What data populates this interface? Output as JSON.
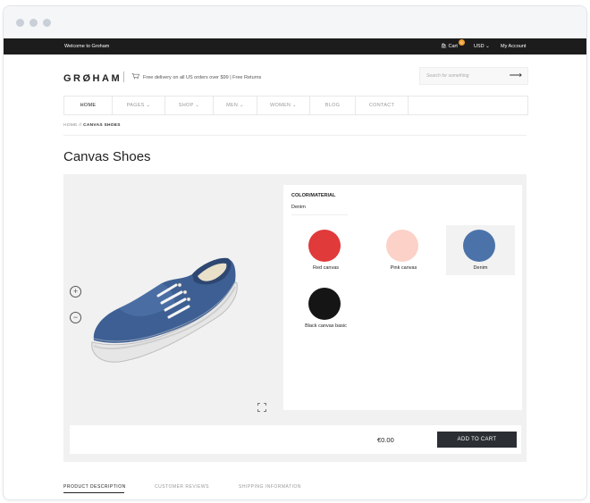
{
  "topbar": {
    "welcome": "Welcome to Groham",
    "cart_label": "Cart",
    "cart_count": "0",
    "currency": "USD",
    "account": "My Account"
  },
  "header": {
    "logo": "GRØHAM",
    "free_delivery": "Free delivery on all US orders over $99 | Free Returns",
    "search_placeholder": "Search for something",
    "search_icon": "arrow-right-icon"
  },
  "nav": {
    "items": [
      {
        "label": "HOME"
      },
      {
        "label": "PAGES"
      },
      {
        "label": "SHOP"
      },
      {
        "label": "MEN"
      },
      {
        "label": "WOMEN"
      },
      {
        "label": "BLOG"
      },
      {
        "label": "CONTACT"
      }
    ]
  },
  "breadcrumb": {
    "home": "HOME",
    "separator": "//",
    "current": "CANVAS SHOES"
  },
  "page": {
    "title": "Canvas Shoes"
  },
  "configurator": {
    "option_label": "COLOR/MATERIAL",
    "selected_value": "Denim",
    "swatches": [
      {
        "label": "Red canvas",
        "color": "#e03a3a",
        "selected": false
      },
      {
        "label": "Pink canvas",
        "color": "#fbd1c8",
        "selected": false
      },
      {
        "label": "Denim",
        "color": "#4b73aa",
        "selected": true
      },
      {
        "label": "Black canvas basic",
        "color": "#151515",
        "selected": false
      }
    ]
  },
  "viewer": {
    "zoom_in_icon": "zoom-in-icon",
    "zoom_out_icon": "zoom-out-icon",
    "fullscreen_icon": "fullscreen-icon",
    "zoom_in_glyph": "+",
    "zoom_out_glyph": "−"
  },
  "cart": {
    "price": "€0.00",
    "add_label": "ADD TO CART"
  },
  "tabs": [
    {
      "label": "PRODUCT DESCRIPTION",
      "active": true
    },
    {
      "label": "CUSTOMER REVIEWS",
      "active": false
    },
    {
      "label": "SHIPPING INFORMATION",
      "active": false
    }
  ],
  "colors": {
    "topbar_bg": "#1c1c1c",
    "badge": "#f0a030",
    "button_bg": "#2b2f33",
    "panel_bg": "#f1f1f1"
  }
}
